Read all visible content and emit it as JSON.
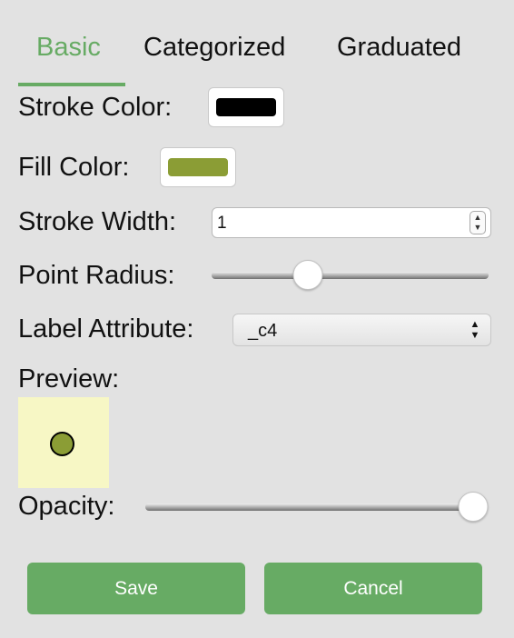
{
  "colors": {
    "accent": "#67ab64",
    "stroke_color": "#000000",
    "fill_color": "#8b9d35",
    "preview_background": "#f7f7c5",
    "button_background": "#67ab64"
  },
  "tabs": [
    {
      "label": "Basic",
      "active": true
    },
    {
      "label": "Categorized",
      "active": false
    },
    {
      "label": "Graduated",
      "active": false
    }
  ],
  "form": {
    "stroke_color_label": "Stroke Color:",
    "fill_color_label": "Fill Color:",
    "stroke_width_label": "Stroke Width:",
    "stroke_width_value": "1",
    "point_radius_label": "Point Radius:",
    "point_radius_fraction": 0.33,
    "label_attribute_label": "Label Attribute:",
    "label_attribute_value": "_c4",
    "preview_label": "Preview:",
    "opacity_label": "Opacity:",
    "opacity_fraction": 1.0
  },
  "buttons": {
    "save_label": "Save",
    "cancel_label": "Cancel"
  },
  "icons": {
    "spinner_up": "▲",
    "spinner_down": "▼",
    "select_up": "▲",
    "select_down": "▼"
  }
}
